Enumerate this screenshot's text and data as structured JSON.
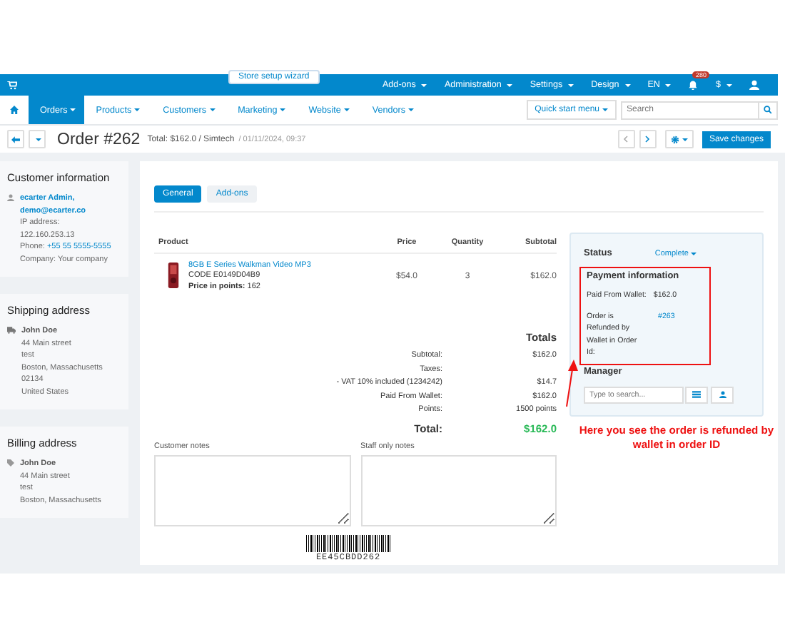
{
  "top_bar": {
    "setup_wizard": "Store setup wizard",
    "menus": [
      "Add-ons",
      "Administration",
      "Settings",
      "Design",
      "EN"
    ],
    "notification_count": "280",
    "currency": "$"
  },
  "nav": {
    "tabs": [
      {
        "label": "Orders",
        "selected": true
      },
      {
        "label": "Products",
        "selected": false
      },
      {
        "label": "Customers",
        "selected": false
      },
      {
        "label": "Marketing",
        "selected": false
      },
      {
        "label": "Website",
        "selected": false
      },
      {
        "label": "Vendors",
        "selected": false
      }
    ],
    "quick_start": "Quick start menu",
    "search": {
      "placeholder": "Search"
    }
  },
  "header": {
    "title": "Order #262",
    "summary": "Total: $162.0 / Simtech",
    "date": "/ 01/11/2024, 09:37",
    "save_button": "Save changes"
  },
  "sidebar": [
    {
      "title": "Customer information",
      "name": "ecarter Admin,",
      "email": "demo@ecarter.co",
      "lines": [
        "IP address:",
        "122.160.253.13"
      ],
      "phone_label": "Phone:",
      "phone": "+55 55 5555-5555",
      "extra": "Company: Your company"
    },
    {
      "title": "Shipping address",
      "name": "John Doe",
      "lines": [
        "44 Main street",
        "test",
        "Boston, Massachusetts",
        "02134",
        "United States"
      ]
    },
    {
      "title": "Billing address",
      "name": "John Doe",
      "lines": [
        "44 Main street",
        "test",
        "Boston, Massachusetts"
      ]
    }
  ],
  "content_tabs": [
    {
      "label": "General",
      "selected": true
    },
    {
      "label": "Add-ons",
      "selected": false
    }
  ],
  "products": {
    "columns": [
      "Product",
      "Price",
      "Quantity",
      "Subtotal"
    ],
    "rows": [
      {
        "name": "8GB E Series Walkman Video MP3",
        "code": "CODE E0149D04B9",
        "points_label": "Price in points:",
        "points": "162",
        "price": "$54.0",
        "quantity": "3",
        "subtotal": "$162.0"
      }
    ]
  },
  "totals": {
    "title": "Totals",
    "rows": [
      {
        "label": "Subtotal:",
        "value": "$162.0"
      },
      {
        "label": "Taxes:",
        "value": ""
      },
      {
        "label": "- VAT 10% included (1234242)",
        "value": "$14.7"
      },
      {
        "label": "Paid From Wallet:",
        "value": "$162.0"
      },
      {
        "label": "Points:",
        "value": "1500 points"
      }
    ],
    "total_label": "Total:",
    "total": "$162.0"
  },
  "status_panel": {
    "status_label": "Status",
    "status": "Complete",
    "payment_title": "Payment information",
    "paid_label": "Paid From Wallet:",
    "paid": "$162.0",
    "refund_label": "Order is Refunded by Wallet in Order Id:",
    "refund_order": "#263",
    "manager_label": "Manager",
    "manager_search": {
      "placeholder": "Type to search..."
    }
  },
  "notes": [
    {
      "label": "Customer notes"
    },
    {
      "label": "Staff only notes"
    }
  ],
  "barcode": "EE45CBDD262",
  "annotation": "Here you see the order is refunded by wallet in order ID"
}
